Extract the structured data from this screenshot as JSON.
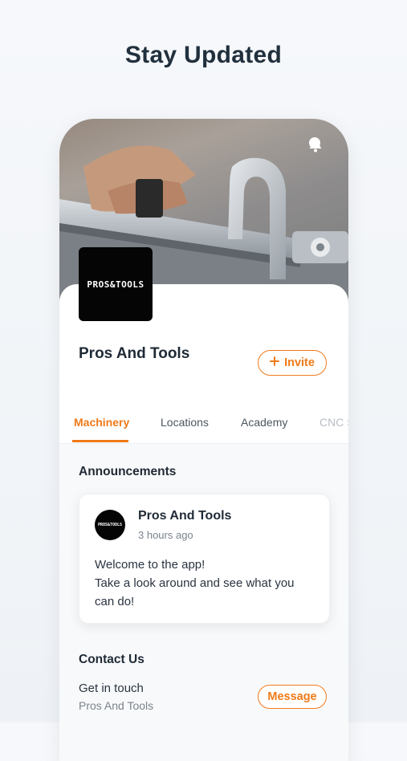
{
  "headline": "Stay Updated",
  "header": {
    "icons": [
      "chat-icon",
      "bell-icon"
    ]
  },
  "profile": {
    "logo_text": "PROS&TOOLS",
    "name": "Pros And Tools",
    "invite_label": "Invite",
    "invite_icon": "plus-icon"
  },
  "tabs": [
    {
      "label": "Machinery",
      "active": true
    },
    {
      "label": "Locations",
      "active": false
    },
    {
      "label": "Academy",
      "active": false
    },
    {
      "label": "CNC S",
      "active": false
    }
  ],
  "announcements": {
    "title": "Announcements",
    "post": {
      "avatar_text": "PROS&TOOLS",
      "author": "Pros And Tools",
      "time": "3 hours ago",
      "line1": "Welcome to the app!",
      "line2": "Take a look around and see what you",
      "line3": "can do!"
    }
  },
  "contact": {
    "title": "Contact Us",
    "primary": "Get in touch",
    "secondary": "Pros And Tools",
    "message_label": "Message"
  },
  "colors": {
    "accent": "#ef7a18",
    "text": "#1f2a36",
    "muted": "#7a838c"
  }
}
